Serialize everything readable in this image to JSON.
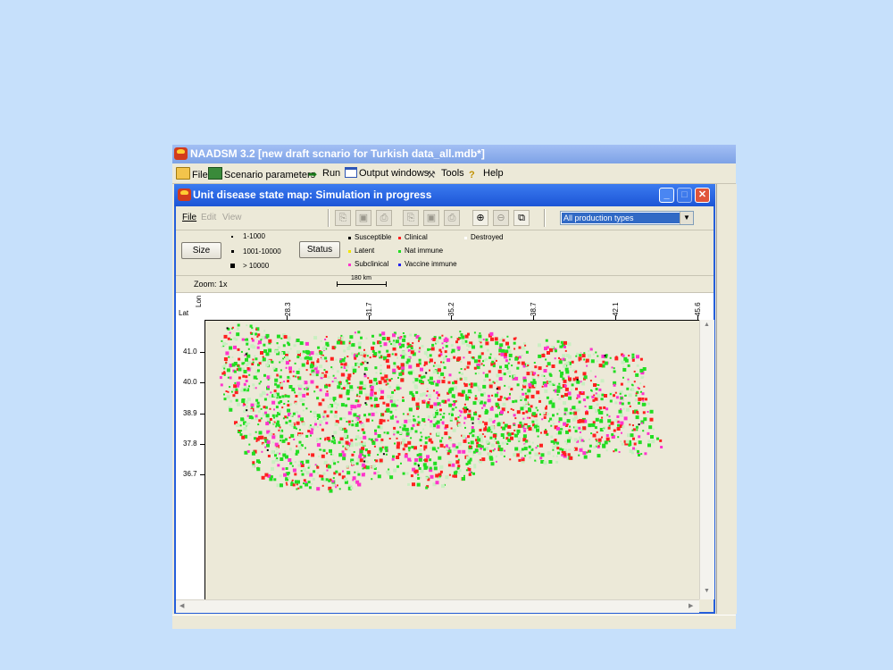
{
  "app": {
    "title": "NAADSM 3.2 [new draft scnario for Turkish data_all.mdb*]",
    "menu": [
      {
        "label": "File",
        "icon": "folder-icon"
      },
      {
        "label": "Scenario parameters",
        "icon": "book-icon"
      },
      {
        "label": "Run",
        "icon": "run-arrow-icon"
      },
      {
        "label": "Output windows",
        "icon": "window-icon"
      },
      {
        "label": "Tools",
        "icon": "tools-icon"
      },
      {
        "label": "Help",
        "icon": "help-icon"
      }
    ]
  },
  "map_window": {
    "title": "Unit disease state map: Simulation in progress",
    "menu": {
      "file": "File",
      "edit": "Edit",
      "view": "View"
    },
    "production_type": "All production types",
    "size_button": "Size",
    "status_button": "Status",
    "size_legend": [
      "1-1000",
      "1001-10000",
      "> 10000"
    ],
    "status_legend": [
      {
        "label": "Susceptible",
        "color": "#000000"
      },
      {
        "label": "Clinical",
        "color": "#ff2020"
      },
      {
        "label": "Destroyed",
        "color": "#ffffff"
      },
      {
        "label": "Latent",
        "color": "#f2e600"
      },
      {
        "label": "Nat immune",
        "color": "#22dd22"
      },
      {
        "label": "Subclinical",
        "color": "#ff33cc"
      },
      {
        "label": "Vaccine immune",
        "color": "#2222ee"
      }
    ],
    "zoom": "Zoom: 1x",
    "scale": "180 km",
    "lon_label": "Lon",
    "lat_label": "Lat",
    "lon_ticks": [
      "28.3",
      "31.7",
      "35.2",
      "38.7",
      "42.1",
      "45.6"
    ],
    "lat_ticks": [
      "41.0",
      "40.0",
      "38.9",
      "37.8",
      "36.7"
    ]
  },
  "colors": {
    "desktop": "#c6e0fb",
    "map_green": "#22dd22",
    "map_red": "#ff2020",
    "map_magenta": "#ff33cc",
    "map_pale": "#c8f0c0"
  }
}
